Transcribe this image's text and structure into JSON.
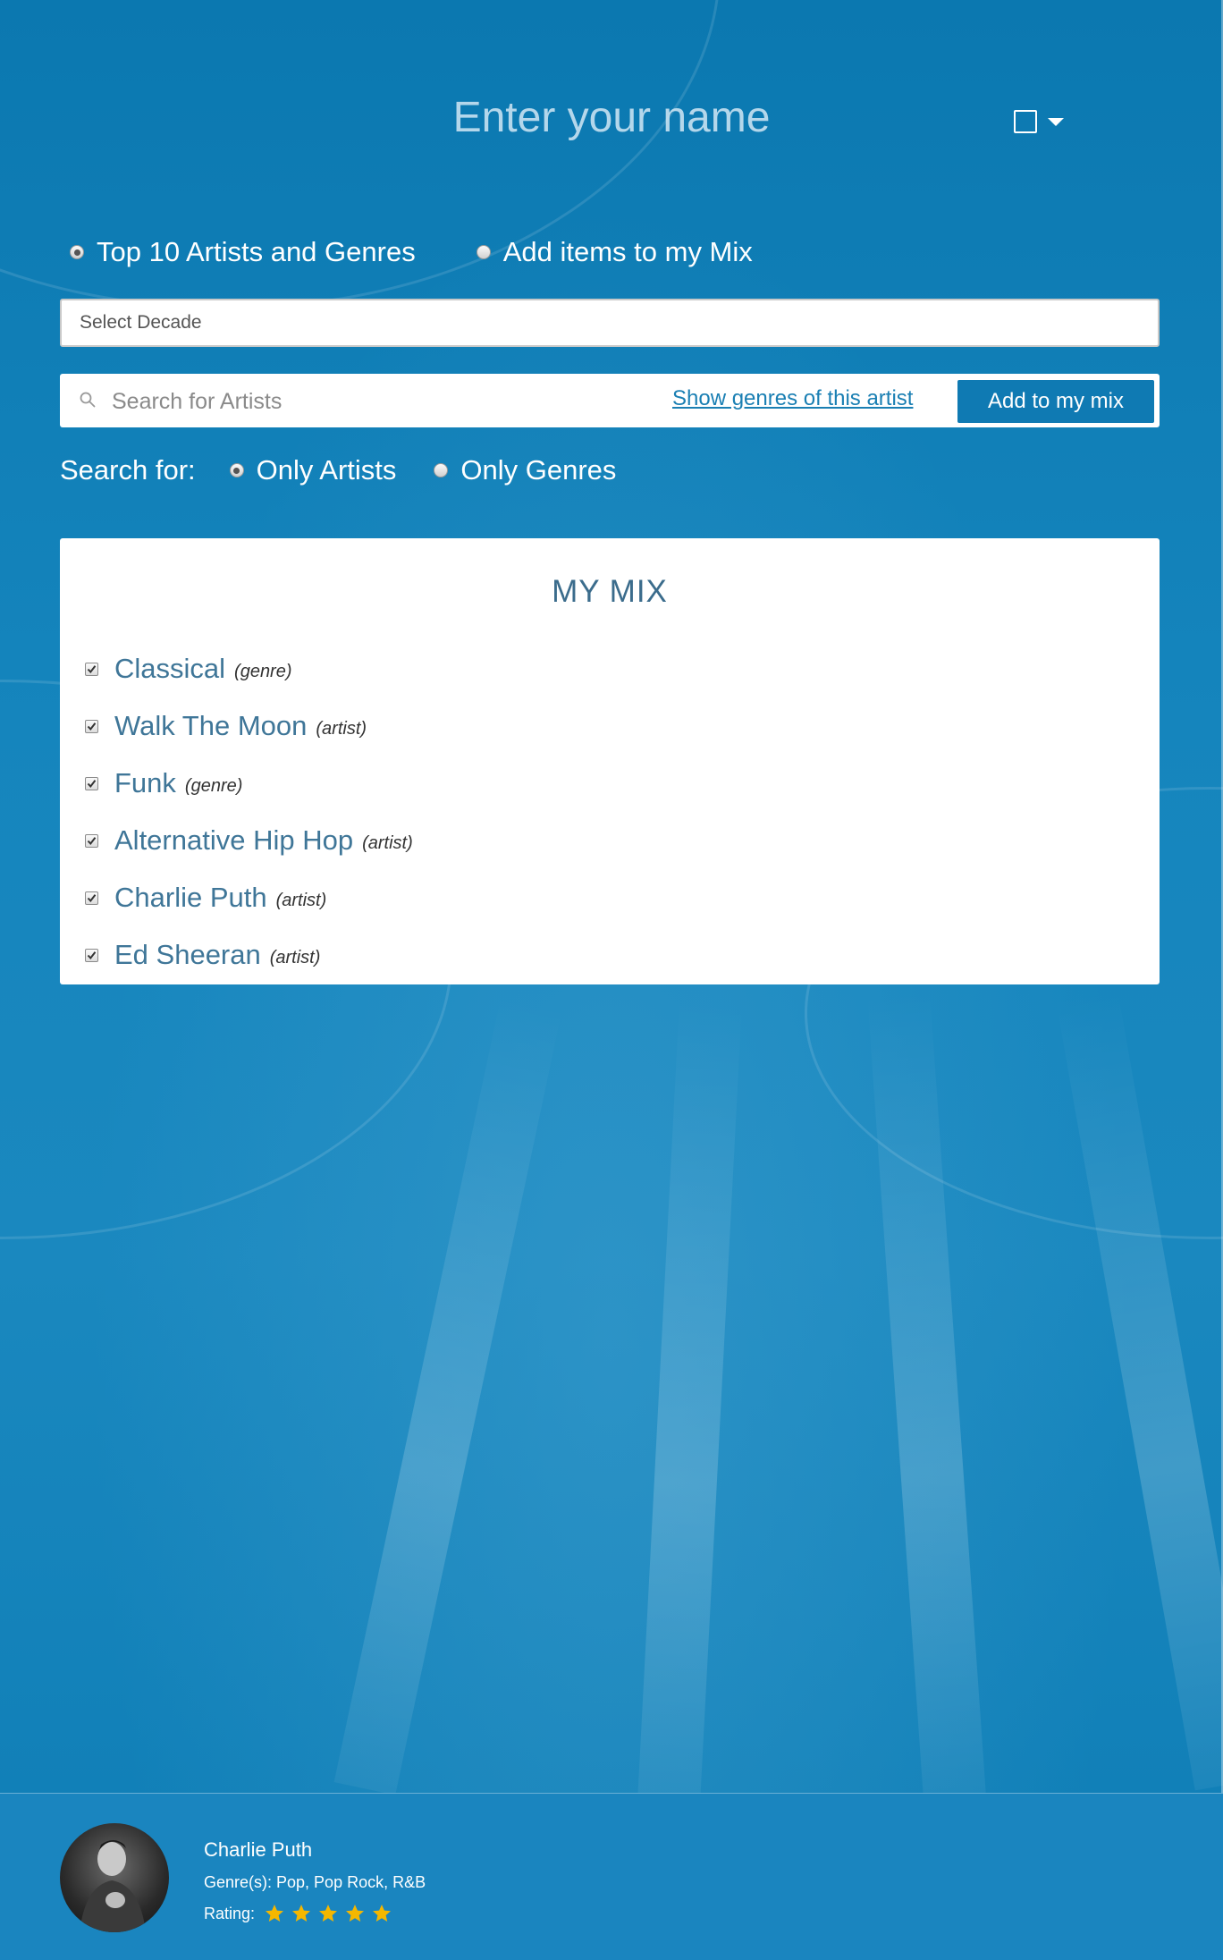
{
  "header": {
    "name_placeholder": "Enter your name",
    "language_toggle_icon": "checkbox-dropdown-icon"
  },
  "mode": {
    "options": [
      "Top 10 Artists and Genres",
      "Add items to my Mix"
    ],
    "selected": "Top 10 Artists and Genres"
  },
  "decade_select": {
    "value": "Select Decade"
  },
  "search": {
    "placeholder": "Search for Artists",
    "value": "",
    "show_genres_label": "Show genres of this artist",
    "add_button_label": "Add to my mix",
    "icon": "search-icon"
  },
  "search_for": {
    "label": "Search for:",
    "options": [
      "Only Artists",
      "Only Genres"
    ],
    "selected": "Only Artists"
  },
  "my_mix": {
    "title": "MY MIX",
    "items": [
      {
        "name": "Classical",
        "type": "(genre)",
        "checked": true
      },
      {
        "name": "Walk The Moon",
        "type": "(artist)",
        "checked": true
      },
      {
        "name": "Funk",
        "type": "(genre)",
        "checked": true
      },
      {
        "name": "Alternative Hip Hop",
        "type": "(artist)",
        "checked": true
      },
      {
        "name": "Charlie Puth",
        "type": "(artist)",
        "checked": true
      },
      {
        "name": "Ed Sheeran",
        "type": "(artist)",
        "checked": true
      }
    ]
  },
  "now_playing": {
    "artist": "Charlie Puth",
    "genres": "Genre(s): Pop, Pop Rock, R&B",
    "rating_label": "Rating:",
    "rating": 5,
    "rating_max": 5,
    "star_color": "#f5b700"
  },
  "colors": {
    "accent": "#0f7ab3",
    "mix_text": "#3f7698",
    "background": "#1585bd"
  }
}
